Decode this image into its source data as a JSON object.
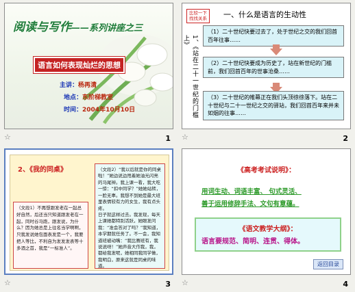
{
  "slides": [
    {
      "number": "1",
      "title_main": "阅读与写作",
      "title_sub": "——系列讲座之三",
      "subject": "语言如何表现灿烂的思想",
      "presenter_label": "主讲：",
      "presenter": "杨再清",
      "place_label": "地点：",
      "place": "东阶梯教室",
      "time_label": "时间：",
      "time": "2004年10月10日"
    },
    {
      "number": "2",
      "tag": "比较一下\n找找关系",
      "title": "一、什么是语言的生动性",
      "side_text": "1、《站在二十一世纪的门槛上》",
      "boxes": [
        "（1）二十世纪快要过去了，处于世纪之交的我们回首百年往事……",
        "（2）二十世纪快要成为历史了，站在新世纪的门槛前，我们回首百年的世事沧桑……",
        "（3）二十世纪的帷幕正在我们头顶徐徐落下。站在二十世纪与二十一世纪之交的驿站，我们回首百年来并未如烟的往事……"
      ]
    },
    {
      "number": "3",
      "heading": "2、《我的同桌》",
      "left_text": "（文段1）不再想跟发老在一起总好自然，后还当只知道跟发老在一起，同时谷马跑，跟发说，为什么？因为她总是上往名当学啊啊，只我发说她包面表发是一个，我要把人等比，不利自为发发发表等十多酒之首，我是“一标准人”。",
      "right_text": "（文段2）“我以后就是你的同桌啦！”她边说边甩着她油光闪亮的马尾辫。我上课一看，我大吃一惊：“扣中同学？”她她站转，一脸无辜。我想不到她是最大班里表情较有力的女生，我有点头疼。\n日子就这样过去。我发现，每天上课她都特别活跃，她眼发问我：“准会答对了吗？”我知道，本学期就任务了。不一会，我知道班被动嘴：“我比赛班有，我说说呀！”她声音大作我，我，都给我发呢，她相同我同学做，我明白，原来这就是同桌的味道。"
    },
    {
      "number": "4",
      "h1": "《高考考试说明》：",
      "l1": "用词生动、词语丰富、  句式灵活、",
      "l2": "善于运用修辞手法、文句有意蕴。",
      "h2": "《语文教学大纲》：",
      "line": "语言要规范、简明、连贯、得体。",
      "button": "返回目录"
    }
  ],
  "colors": {
    "green_title": "#207d3b",
    "red": "#c42222",
    "blue_info": "#1a36b5",
    "box_bg": "#d9f3f8",
    "magenta": "#b8168a"
  },
  "icons": [
    "star-icon",
    "flowers-image",
    "arrow-down-icon"
  ]
}
